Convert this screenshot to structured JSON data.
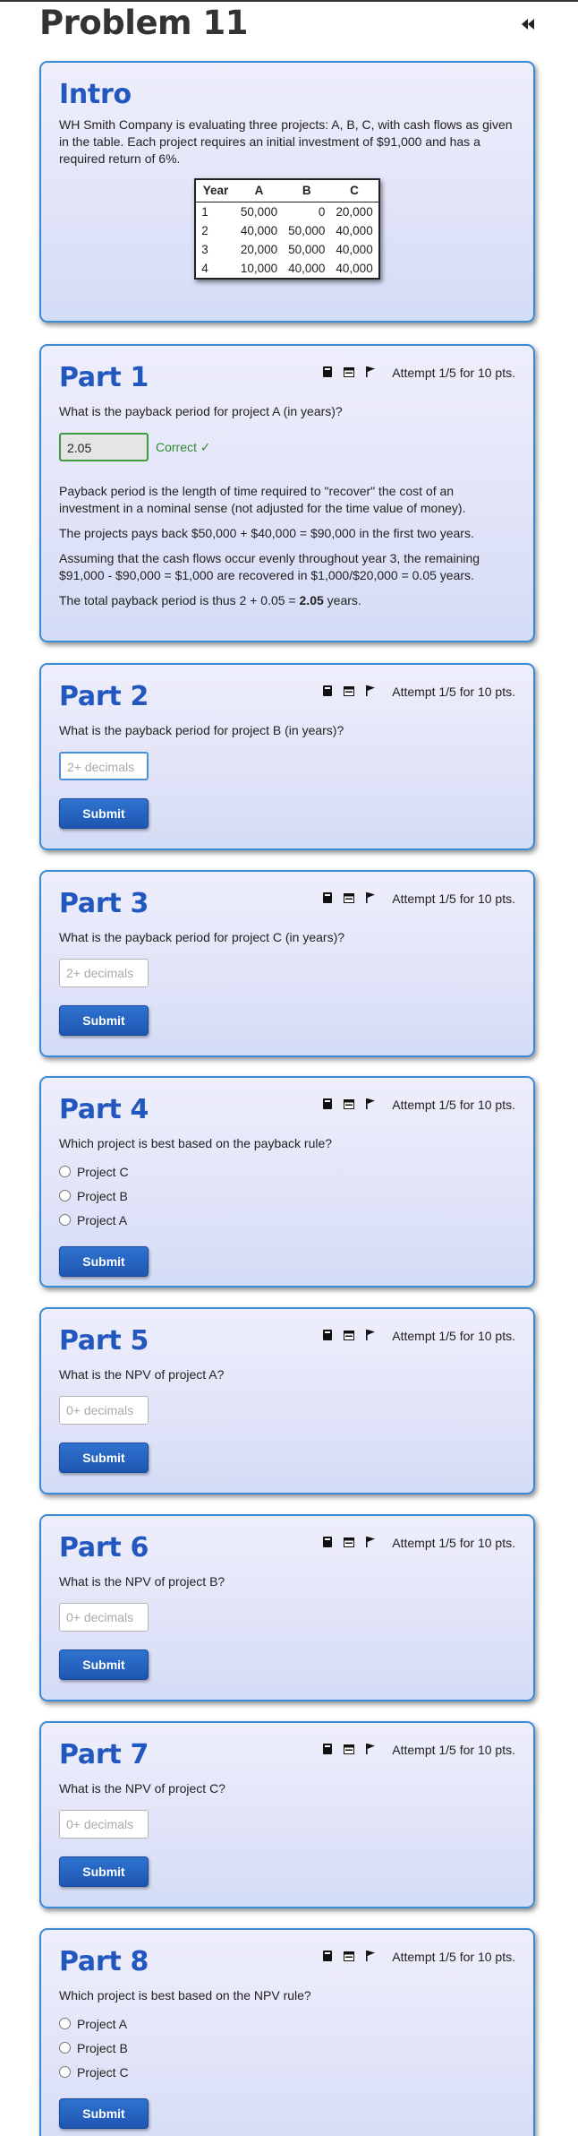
{
  "page": {
    "title": "Problem 11"
  },
  "intro": {
    "heading": "Intro",
    "text": "WH Smith Company is evaluating three projects: A, B, C, with cash flows as given in the table. Each project requires an initial investment of $91,000 and has a required return of 6%.",
    "table": {
      "headers": [
        "Year",
        "A",
        "B",
        "C"
      ],
      "rows": [
        [
          "1",
          "50,000",
          "0",
          "20,000"
        ],
        [
          "2",
          "40,000",
          "50,000",
          "40,000"
        ],
        [
          "3",
          "20,000",
          "50,000",
          "40,000"
        ],
        [
          "4",
          "10,000",
          "40,000",
          "40,000"
        ]
      ]
    }
  },
  "attempt_text": "Attempt 1/5 for 10 pts.",
  "submit_label": "Submit",
  "parts": [
    {
      "title": "Part 1",
      "question": "What is the payback period for project A (in years)?",
      "answer": "2.05",
      "status": "Correct ✓",
      "solution": {
        "p1": "Payback period is the length of time required to \"recover\" the cost of an investment in a nominal sense (not adjusted for the time value of money).",
        "p2": "The projects pays back $50,000 + $40,000 = $90,000 in the first two years.",
        "p3": "Assuming that the cash flows occur evenly throughout year 3, the remaining $91,000 - $90,000 = $1,000 are recovered in $1,000/$20,000 = 0.05 years.",
        "p4_pre": "The total payback period is thus 2 + 0.05 = ",
        "p4_bold": "2.05",
        "p4_post": " years."
      }
    },
    {
      "title": "Part 2",
      "question": "What is the payback period for project B (in years)?",
      "placeholder": "2+ decimals"
    },
    {
      "title": "Part 3",
      "question": "What is the payback period for project C (in years)?",
      "placeholder": "2+ decimals"
    },
    {
      "title": "Part 4",
      "question": "Which project is best based on the payback rule?",
      "options": [
        "Project C",
        "Project B",
        "Project A"
      ]
    },
    {
      "title": "Part 5",
      "question": "What is the NPV of project A?",
      "placeholder": "0+ decimals"
    },
    {
      "title": "Part 6",
      "question": "What is the NPV of project B?",
      "placeholder": "0+ decimals"
    },
    {
      "title": "Part 7",
      "question": "What is the NPV of project C?",
      "placeholder": "0+ decimals"
    },
    {
      "title": "Part 8",
      "question": "Which project is best based on the NPV rule?",
      "options": [
        "Project A",
        "Project B",
        "Project C"
      ]
    }
  ],
  "icons": {
    "calculator": "calculator-icon",
    "notes": "notes-icon",
    "flag": "flag-icon",
    "back": "rewind-icon"
  }
}
